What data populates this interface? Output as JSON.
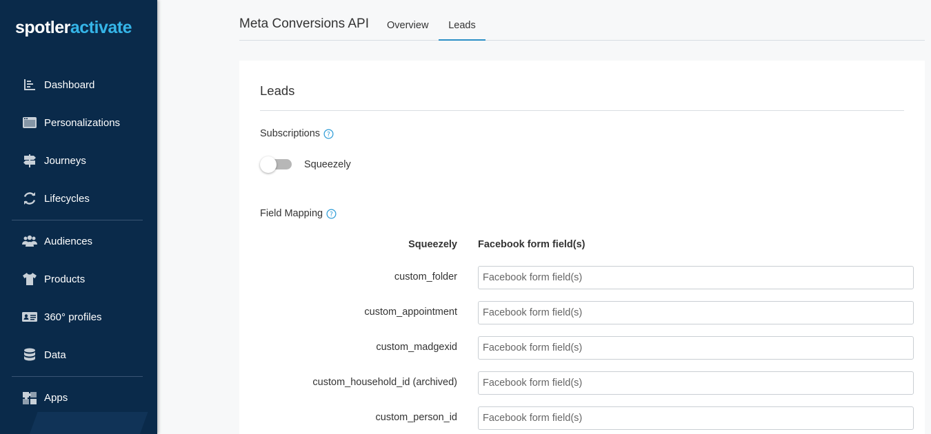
{
  "brand": {
    "part1": "spotler",
    "part2": "activate"
  },
  "nav": {
    "items": [
      {
        "id": "dashboard",
        "label": "Dashboard",
        "icon": "dashboard-icon"
      },
      {
        "id": "personalizations",
        "label": "Personalizations",
        "icon": "browser-window-icon"
      },
      {
        "id": "journeys",
        "label": "Journeys",
        "icon": "signpost-icon"
      },
      {
        "id": "lifecycles",
        "label": "Lifecycles",
        "icon": "refresh-icon"
      },
      {
        "id": "audiences",
        "label": "Audiences",
        "icon": "users-icon"
      },
      {
        "id": "products",
        "label": "Products",
        "icon": "tshirt-icon"
      },
      {
        "id": "profiles",
        "label": "360° profiles",
        "icon": "id-card-icon"
      },
      {
        "id": "data",
        "label": "Data",
        "icon": "database-icon"
      },
      {
        "id": "apps",
        "label": "Apps",
        "icon": "puzzle-icon"
      }
    ]
  },
  "header": {
    "title": "Meta Conversions API",
    "tabs": [
      {
        "label": "Overview",
        "active": false
      },
      {
        "label": "Leads",
        "active": true
      }
    ]
  },
  "card": {
    "title": "Leads",
    "subscriptions": {
      "label": "Subscriptions",
      "toggle_label": "Squeezely",
      "toggle_on": false
    },
    "field_mapping": {
      "label": "Field Mapping",
      "col_left": "Squeezely",
      "col_right": "Facebook form field(s)",
      "rows": [
        {
          "field": "custom_folder",
          "value": "",
          "placeholder": "Facebook form field(s)"
        },
        {
          "field": "custom_appointment",
          "value": "",
          "placeholder": "Facebook form field(s)"
        },
        {
          "field": "custom_madgexid",
          "value": "",
          "placeholder": "Facebook form field(s)"
        },
        {
          "field": "custom_household_id (archived)",
          "value": "",
          "placeholder": "Facebook form field(s)"
        },
        {
          "field": "custom_person_id",
          "value": "",
          "placeholder": "Facebook form field(s)"
        }
      ]
    }
  },
  "colors": {
    "sidebar_bg": "#0a2a4a",
    "brand_accent": "#35b5e8",
    "tab_active": "#2a8fc6",
    "help_icon": "#2a9ad6"
  }
}
